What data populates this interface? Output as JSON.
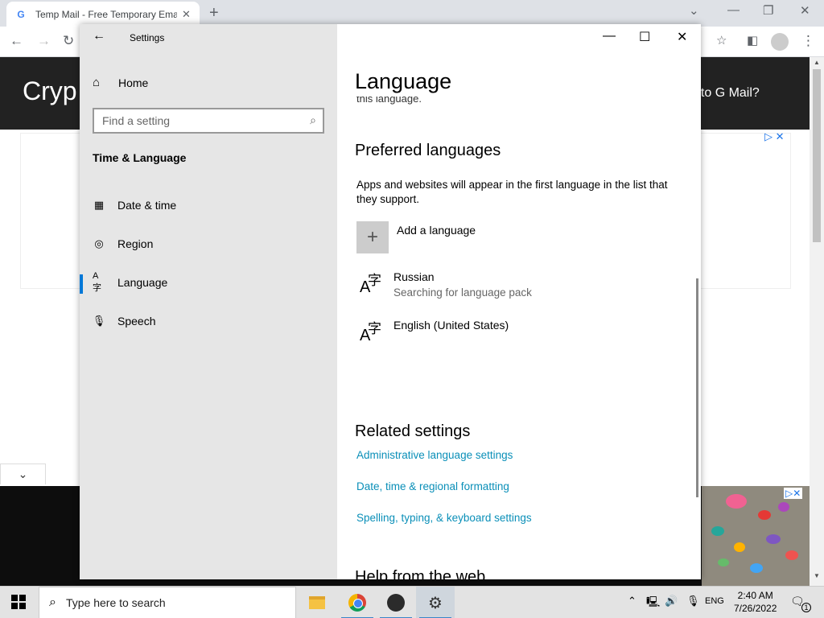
{
  "browser": {
    "tab_title": "Temp Mail - Free Temporary Ema",
    "header_logo": "Cryp",
    "header_right": "oto G Mail?"
  },
  "settings": {
    "window_title": "Settings",
    "sidebar": {
      "home_label": "Home",
      "search_placeholder": "Find a setting",
      "section_title": "Time & Language",
      "items": [
        {
          "label": "Date & time",
          "icon": "calendar-clock-icon"
        },
        {
          "label": "Region",
          "icon": "globe-icon"
        },
        {
          "label": "Language",
          "icon": "language-icon",
          "active": true
        },
        {
          "label": "Speech",
          "icon": "microphone-icon"
        }
      ]
    },
    "content": {
      "title": "Language",
      "cutoff_text": "this language.",
      "preferred_heading": "Preferred languages",
      "preferred_desc": "Apps and websites will appear in the first language in the list that they support.",
      "add_language": "Add a language",
      "languages": [
        {
          "name": "Russian",
          "status": "Searching for language pack"
        },
        {
          "name": "English (United States)",
          "status": ""
        }
      ],
      "related_heading": "Related settings",
      "related_links": [
        "Administrative language settings",
        "Date, time & regional formatting",
        "Spelling, typing, & keyboard settings"
      ],
      "help_heading": "Help from the web"
    }
  },
  "taskbar": {
    "search_placeholder": "Type here to search",
    "lang": "ENG",
    "time": "2:40 AM",
    "date": "7/26/2022",
    "notification_count": "1"
  },
  "colors": {
    "accent": "#0078d7",
    "link": "#0a8fb8",
    "sidebar_bg": "#e6e6e6"
  }
}
